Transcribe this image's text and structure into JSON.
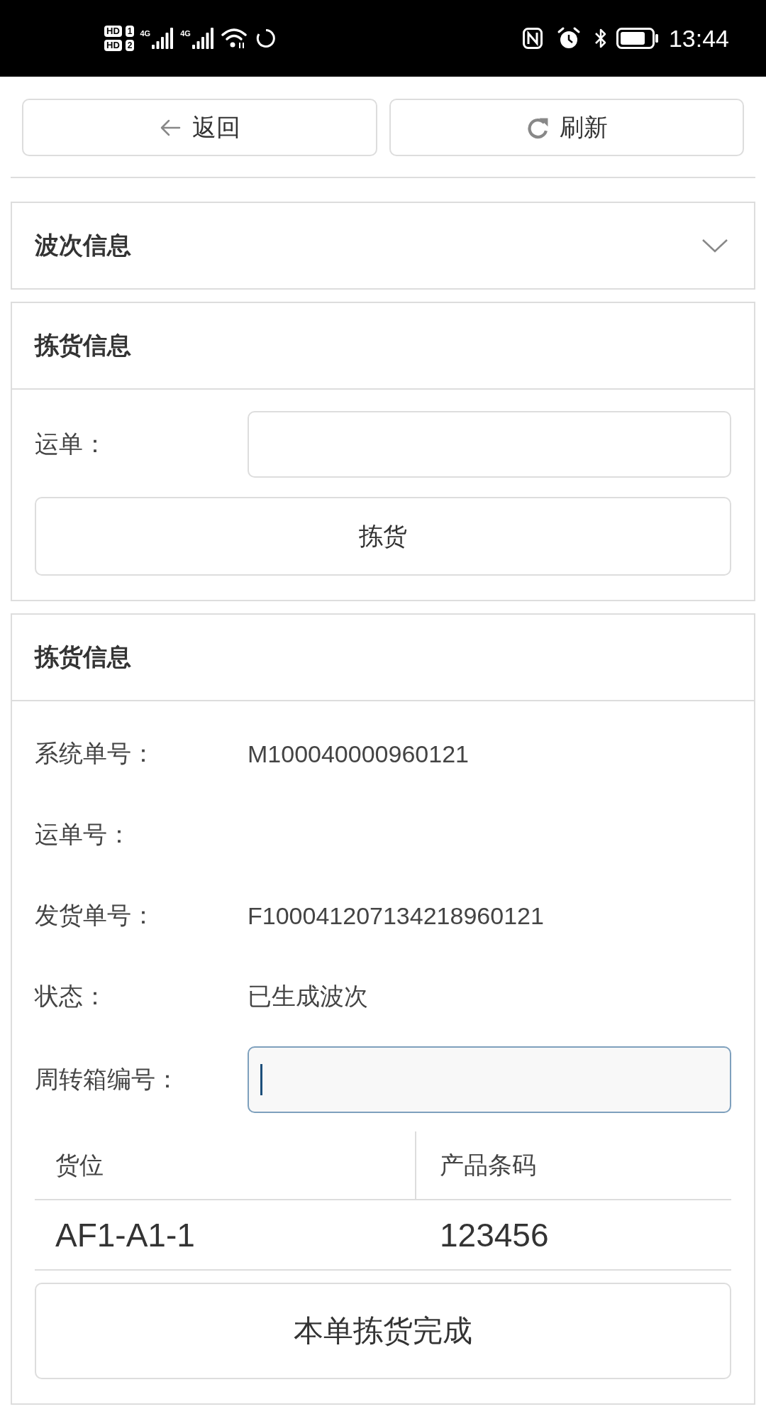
{
  "status_bar": {
    "sims": [
      {
        "badge": "HD",
        "slot": "1"
      },
      {
        "badge": "HD",
        "slot": "2"
      }
    ],
    "networks": [
      {
        "type": "4G"
      },
      {
        "type": "4G"
      }
    ],
    "time": "13:44"
  },
  "toolbar": {
    "buttons": [
      {
        "kind": "back",
        "label": "返回"
      },
      {
        "kind": "refresh",
        "label": "刷新"
      }
    ]
  },
  "panels": [
    {
      "kind": "collapsible",
      "title": "波次信息",
      "expanded": false
    },
    {
      "kind": "section",
      "title": "拣货信息",
      "items": [
        {
          "kind": "field",
          "label": "运单：",
          "focused": false
        },
        {
          "kind": "button",
          "label": "拣货"
        }
      ]
    },
    {
      "kind": "section",
      "title": "拣货信息",
      "items": [
        {
          "kind": "detail",
          "label": "系统单号：",
          "value": "M100040000960121"
        },
        {
          "kind": "detail",
          "label": "运单号："
        },
        {
          "kind": "detail",
          "label": "发货单号：",
          "value": "F100041207134218960121"
        },
        {
          "kind": "detail",
          "label": "状态：",
          "value": "已生成波次"
        },
        {
          "kind": "field",
          "label": "周转箱编号：",
          "focused": true
        },
        {
          "kind": "table",
          "columns": [
            "货位",
            "产品条码"
          ],
          "rows": [
            {
              "cells": [
                "AF1-A1-1",
                "123456"
              ]
            }
          ]
        },
        {
          "kind": "large_button",
          "label": "本单拣货完成"
        }
      ]
    }
  ]
}
